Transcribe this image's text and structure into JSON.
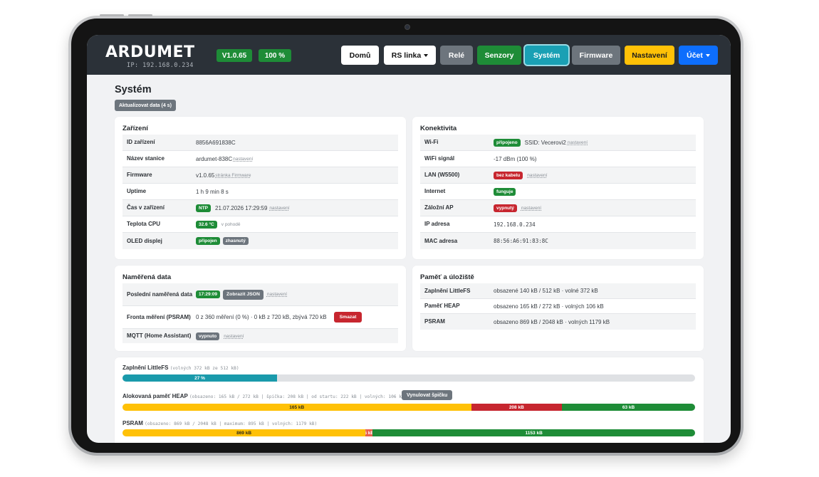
{
  "header": {
    "logo_text": "ARDUMET",
    "ip_line": "IP: 192.168.0.234",
    "version_badge": "V1.0.65",
    "signal_badge": "100 %",
    "nav": {
      "home": "Domů",
      "rs_link": "RS linka",
      "relay": "Relé",
      "sensors": "Senzory",
      "system": "Systém",
      "firmware": "Firmware",
      "settings": "Nastavení",
      "account": "Účet"
    }
  },
  "colors": {
    "navbar": "#2b3138",
    "green": "#1e8c37",
    "teal_active": "#1aa0b4",
    "gray_button": "#6d757d",
    "yellow": "#ffc107",
    "blue": "#0d6efd",
    "red": "#c7262f"
  },
  "page": {
    "title": "Systém",
    "refresh_button": "Aktualizovat data (4 s)"
  },
  "device": {
    "title": "Zařízení",
    "id_label": "ID zařízení",
    "id_value": "8856A691838C",
    "name_label": "Název stanice",
    "name_value": "ardumet-838C",
    "name_link": "nastavení",
    "firmware_label": "Firmware",
    "firmware_value": "v1.0.65",
    "firmware_link": "stránka Firmware",
    "uptime_label": "Uptime",
    "uptime_value": "1 h 9 min 8 s",
    "time_label": "Čas v zařízení",
    "time_badge": "NTP",
    "time_value": "21.07.2026 17:29:59",
    "time_link": "nastavení",
    "cpu_label": "Teplota CPU",
    "cpu_badge": "32.6 °C",
    "cpu_note": "v pohodě",
    "oled_label": "OLED displej",
    "oled_badge1": "připojen",
    "oled_badge2": "zhasnutý"
  },
  "connectivity": {
    "title": "Konektivita",
    "wifi_label": "Wi-Fi",
    "wifi_badge": "připojeno",
    "wifi_ssid": "SSID: Vecerovi2",
    "wifi_link": "nastavení",
    "signal_label": "WiFi signál",
    "signal_value": "-17 dBm (100 %)",
    "lan_label": "LAN (W5500)",
    "lan_badge": "bez kabelu",
    "lan_link": "nastavení",
    "internet_label": "Internet",
    "internet_badge": "funguje",
    "ap_label": "Záložní AP",
    "ap_badge": "vypnutý",
    "ap_link": "nastavení",
    "ip_label": "IP adresa",
    "ip_value": "192.168.0.234",
    "mac_label": "MAC adresa",
    "mac_value": "88:56:A6:91:83:8C"
  },
  "measured": {
    "title": "Naměřená data",
    "last_label": "Poslední naměřená data",
    "last_badge": "17:29:09",
    "show_json": "Zobrazit JSON",
    "last_link": "nastavení",
    "queue_label": "Fronta měření (PSRAM)",
    "queue_value": "0 z 360 měření (0 %) · 0 kB z 720 kB, zbývá 720 kB",
    "queue_button": "Smazat",
    "mqtt_label": "MQTT (Home Assistant)",
    "mqtt_badge": "vypnuto",
    "mqtt_link": "nastavení"
  },
  "memory": {
    "title": "Paměť a úložiště",
    "littlefs_label": "Zaplnění LittleFS",
    "littlefs_value": "obsazené 140 kB / 512 kB · volné 372 kB",
    "heap_label": "Paměť HEAP",
    "heap_value": "obsazeno 165 kB / 272 kB · volných 106 kB",
    "psram_label": "PSRAM",
    "psram_value": "obsazeno 869 kB / 2048 kB · volných 1179 kB"
  },
  "bars": {
    "littlefs": {
      "title": "Zaplnění LittleFS",
      "sub": "(volných 372 kB ze 512 kB)",
      "fill_fraction": 0.27,
      "fill_label": "27 %"
    },
    "heap": {
      "title": "Alokovaná paměť HEAP",
      "sub": "(obsazeno: 165 kB / 272 kB | špička: 208 kB | od startu: 222 kB | volných: 106 kB)",
      "reset_button": "Vynulovat špičku",
      "segments": [
        {
          "value": 165,
          "label": "165 kB",
          "color": "#ffc107"
        },
        {
          "value": 43,
          "label": "208 kB",
          "color": "#c7262f"
        },
        {
          "value": 63,
          "label": "63 kB",
          "color": "#1e8c37"
        }
      ]
    },
    "psram": {
      "title": "PSRAM",
      "sub": "(obsazeno: 869 kB / 2048 kB | maximum: 895 kB | volných: 1179 kB)",
      "segments": [
        {
          "value": 869,
          "label": "869 kB",
          "color": "#ffc107"
        },
        {
          "value": 26,
          "label": "5 kB",
          "color": "#e8604c"
        },
        {
          "value": 1153,
          "label": "1153 kB",
          "color": "#1e8c37"
        }
      ]
    }
  }
}
